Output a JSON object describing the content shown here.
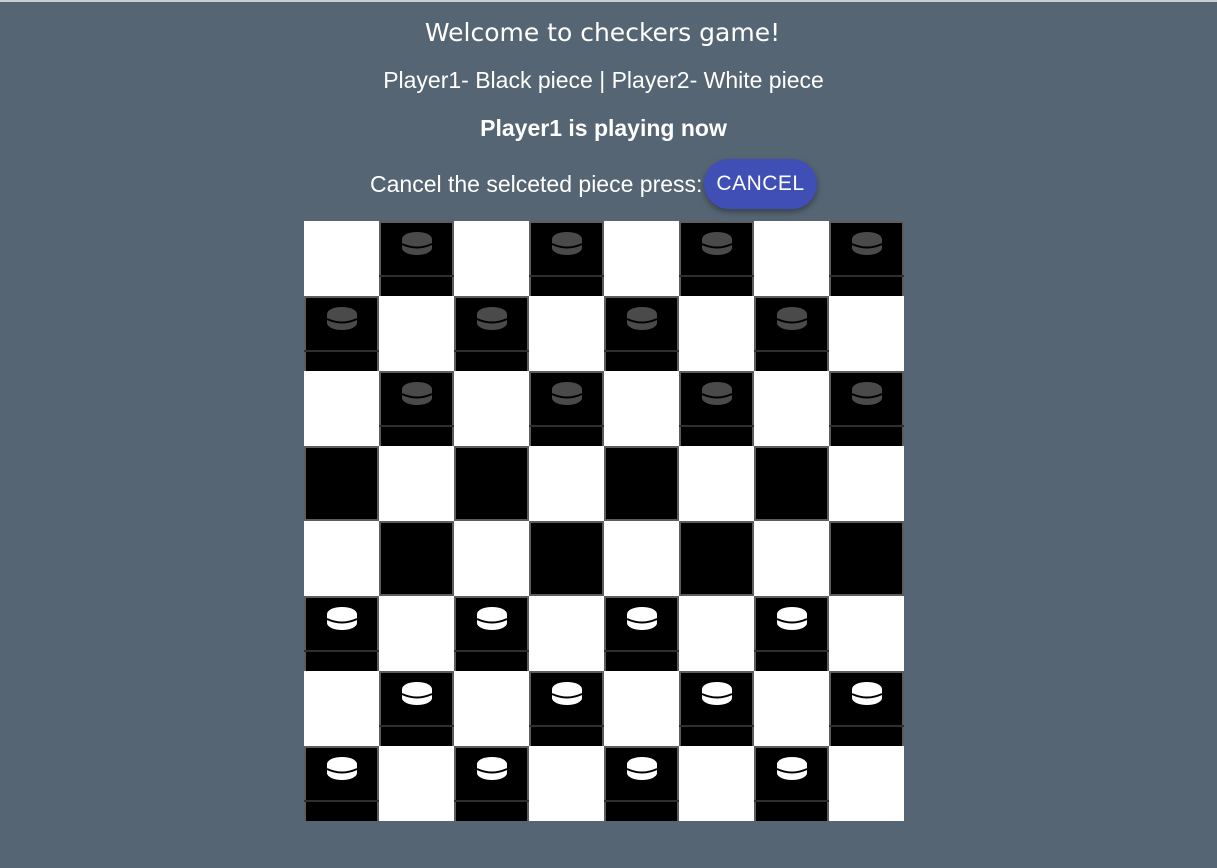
{
  "header": {
    "title": "Welcome to checkers game!",
    "players": "Player1- Black piece | Player2- White piece",
    "turn": "Player1 is playing now",
    "cancel_label": "Cancel the selceted piece press:",
    "cancel_button": "CANCEL"
  },
  "colors": {
    "background": "#566573",
    "button": "#3f4fb5",
    "player1_piece": "#4a4a4a",
    "player2_piece": "#ffffff",
    "dark_square": "#000000",
    "light_square": "#ffffff"
  },
  "board": {
    "size": 8,
    "rows": [
      ". b . b . b . b",
      "b . b . b . b .",
      ". b . b . b . b",
      ". . . . . . . .",
      ". . . . . . . .",
      "w . w . w . w .",
      ". w . w . w . w",
      "w . w . w . w ."
    ]
  }
}
